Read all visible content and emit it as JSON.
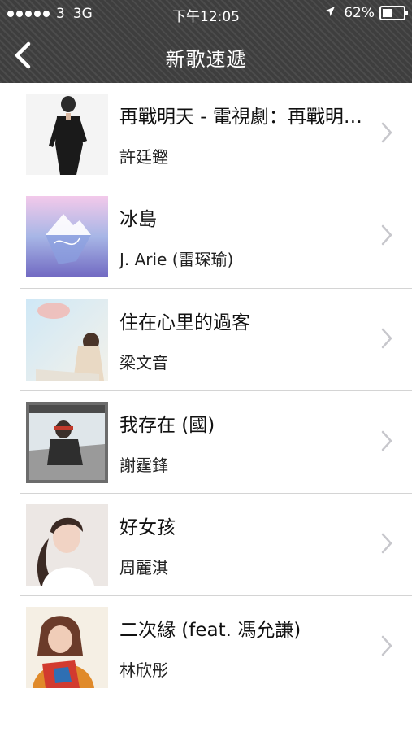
{
  "status_bar": {
    "signal_dots": 5,
    "carrier": "3",
    "network": "3G",
    "time": "下午12:05",
    "battery": "62%",
    "battery_level": 0.62
  },
  "nav": {
    "title": "新歌速遞",
    "back_icon": "chevron-left-icon"
  },
  "songs": [
    {
      "title": "再戰明天 - 電視劇：再戰明天主題曲",
      "artist": "許廷鏗"
    },
    {
      "title": "冰島",
      "artist": "J. Arie (雷琛瑜)"
    },
    {
      "title": "住在心里的過客",
      "artist": "梁文音"
    },
    {
      "title": "我存在 (國)",
      "artist": "謝霆鋒"
    },
    {
      "title": "好女孩",
      "artist": "周麗淇"
    },
    {
      "title": "二次緣 (feat. 馮允謙)",
      "artist": "林欣彤"
    }
  ],
  "colors": {
    "nav_background": "#3e3e3e",
    "separator": "#d4d4d4",
    "chevron": "#c7c7cc"
  }
}
